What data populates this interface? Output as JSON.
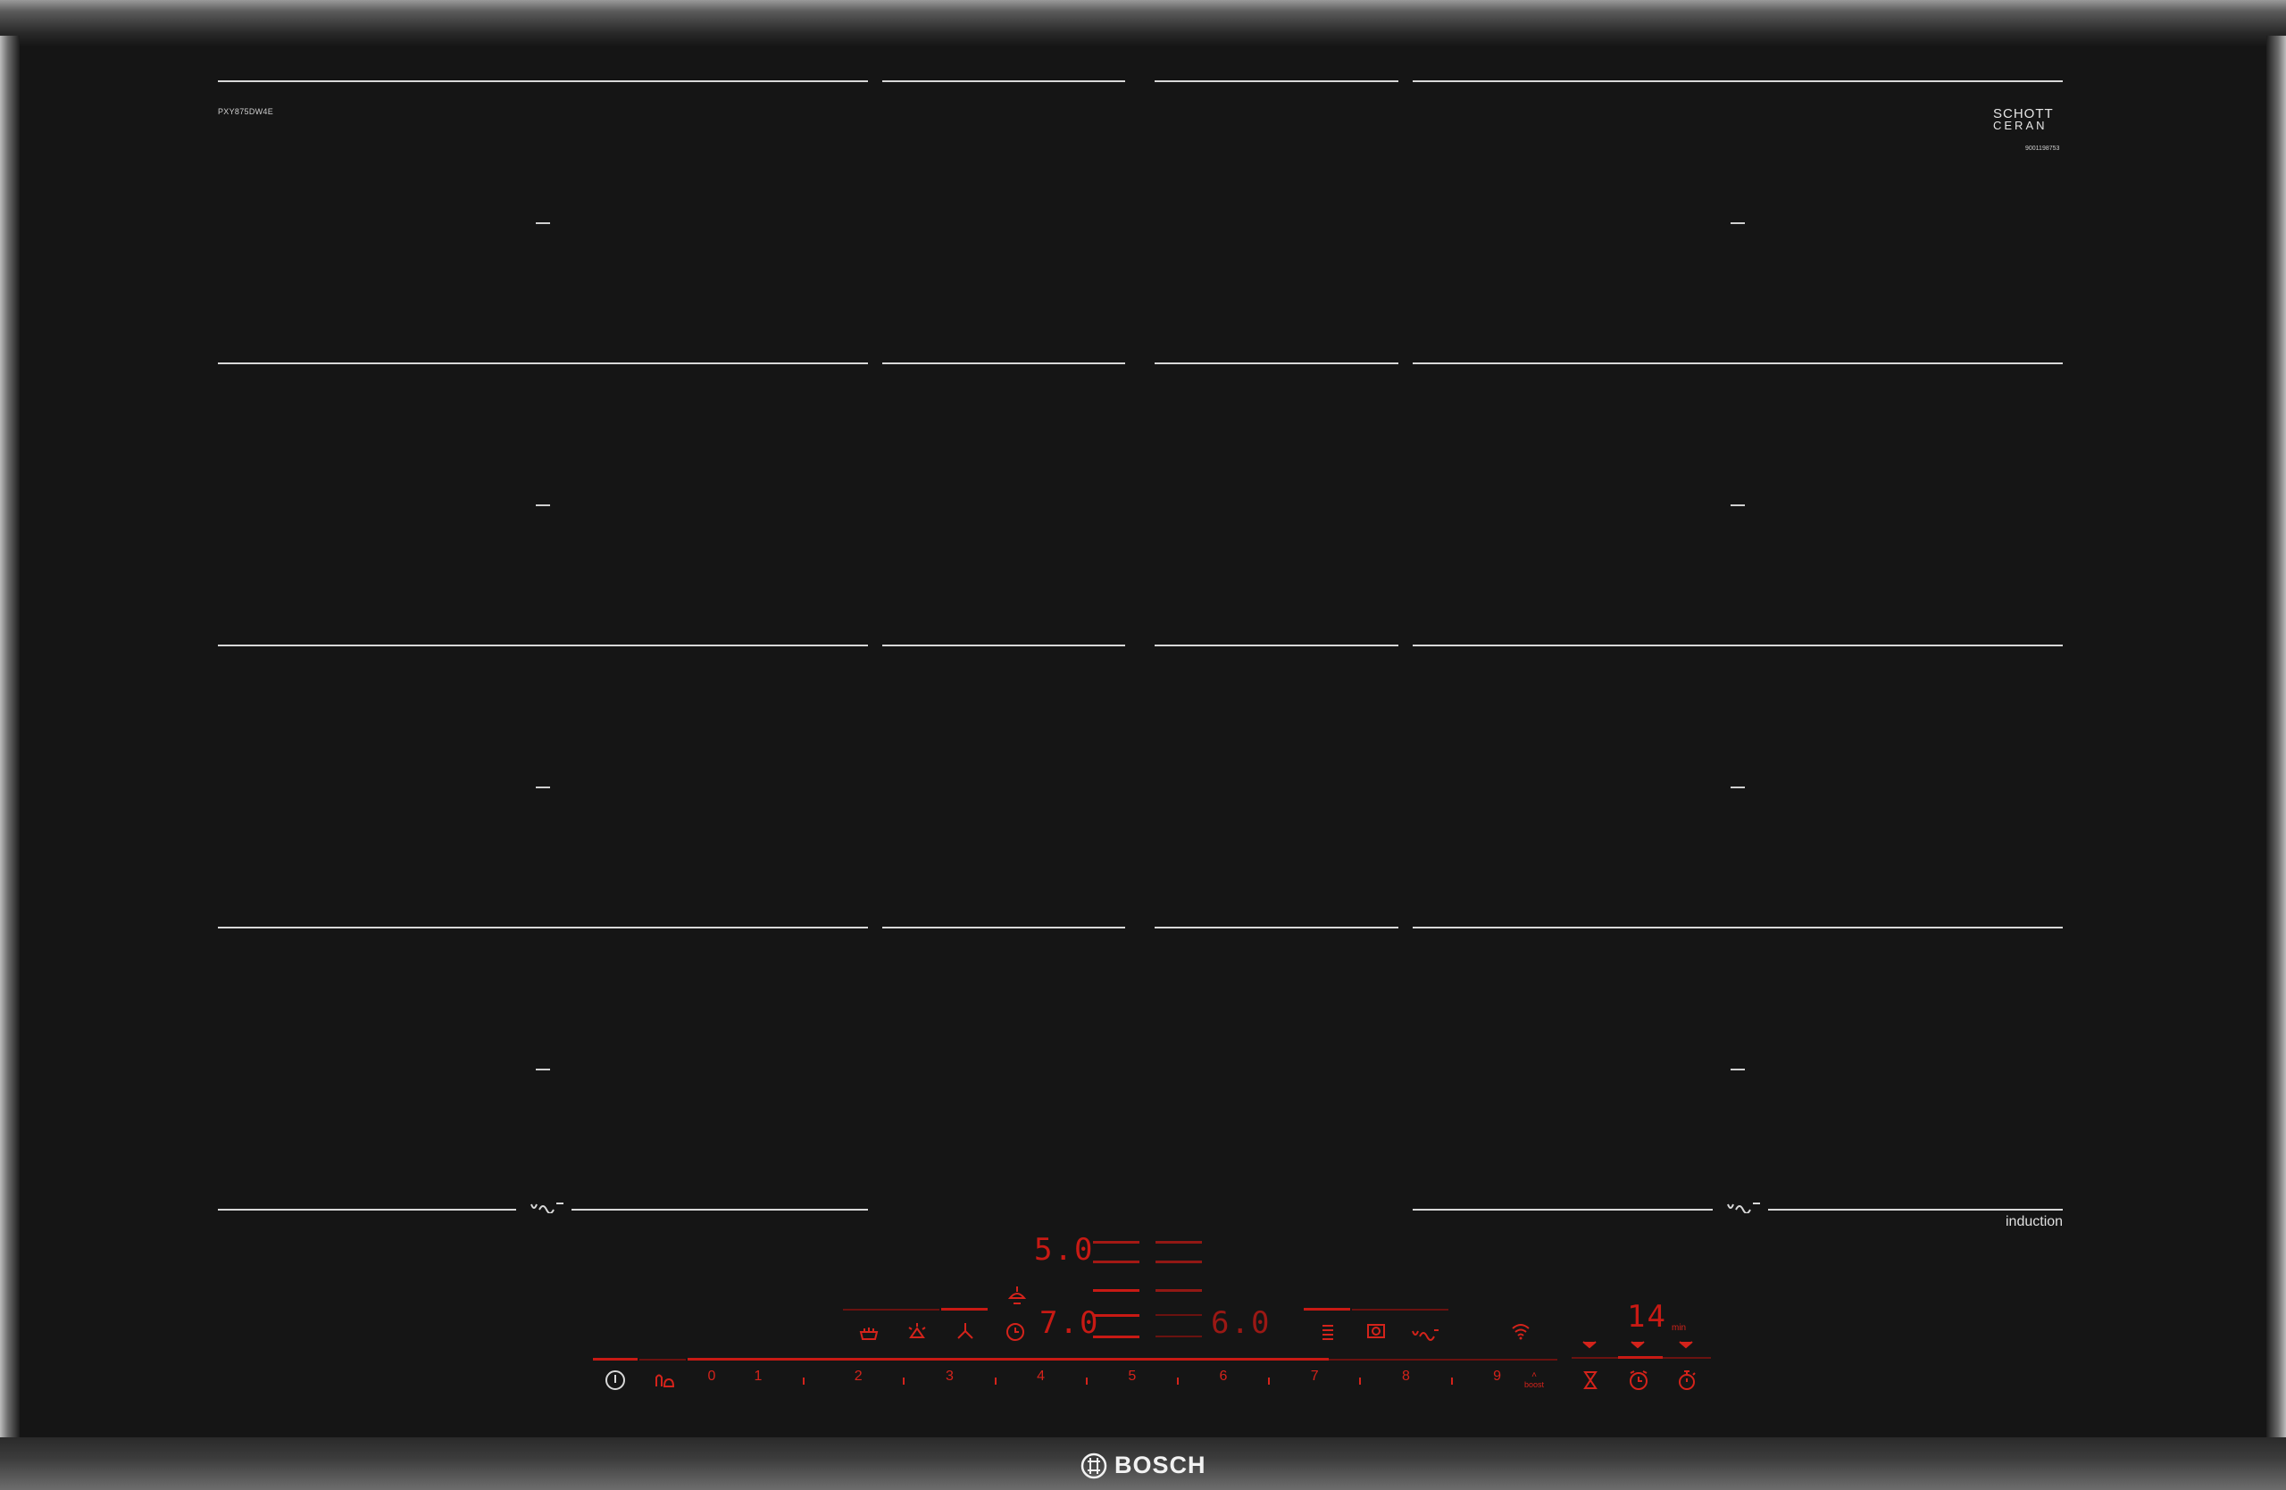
{
  "model_number": "PXY875DW4E",
  "glass_brand_line1": "SCHOTT",
  "glass_brand_line2": "CERAN",
  "serial_number": "9001198753",
  "surface_label": "induction",
  "brand": "BOSCH",
  "displays": {
    "top": "5.0",
    "left": "7.0",
    "right": "6.0",
    "timer": "14",
    "timer_unit": "min"
  },
  "slider_labels": [
    "0",
    "1",
    "2",
    "3",
    "4",
    "5",
    "6",
    "7",
    "8",
    "9"
  ],
  "boost_label": "boost",
  "icons": {
    "power": "power-icon",
    "child_lock": "child-lock-icon",
    "pot": "cooking-pot-icon",
    "frying": "frying-sensor-icon",
    "fan": "hood-fan-icon",
    "light": "hood-light-icon",
    "clock": "cooking-timer-icon",
    "move": "flex-move-icon",
    "cooking_sensor": "cooking-sensor-icon",
    "flex": "flex-zone-icon",
    "wifi": "wifi-icon",
    "hourglass": "hourglass-icon",
    "alarm": "alarm-clock-icon",
    "stopwatch": "stopwatch-icon"
  },
  "colors": {
    "display_red": "#c81a14",
    "glass": "#151515"
  }
}
